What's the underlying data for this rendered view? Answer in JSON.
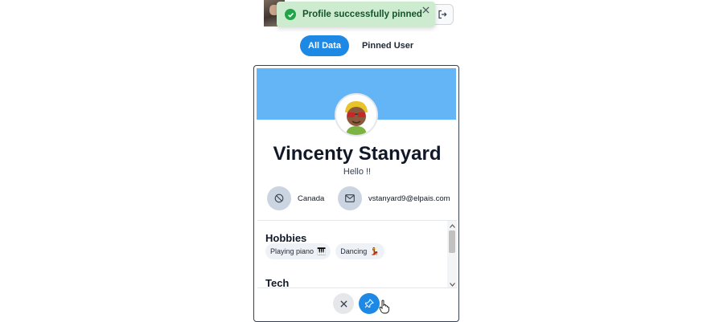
{
  "toast": {
    "message": "Profile successfully pinned",
    "icon": "check-circle-icon",
    "close_icon": "close-icon",
    "color": "#cdeccf"
  },
  "tabs": [
    {
      "label": "All Data",
      "active": true
    },
    {
      "label": "Pinned User",
      "active": false
    }
  ],
  "profile": {
    "name": "Vincenty Stanyard",
    "greeting": "Hello !!",
    "location": "Canada",
    "email": "vstanyard9@elpais.com",
    "banner_color": "#64b5f6"
  },
  "sections": {
    "hobbies_title": "Hobbies",
    "hobbies": [
      {
        "label": "Playing piano",
        "emoji": "🎹"
      },
      {
        "label": "Dancing",
        "emoji": "💃"
      }
    ],
    "tech_title": "Tech"
  },
  "actions": {
    "close_icon": "close-icon",
    "pin_icon": "pin-icon"
  },
  "accent": "#1e88e5"
}
